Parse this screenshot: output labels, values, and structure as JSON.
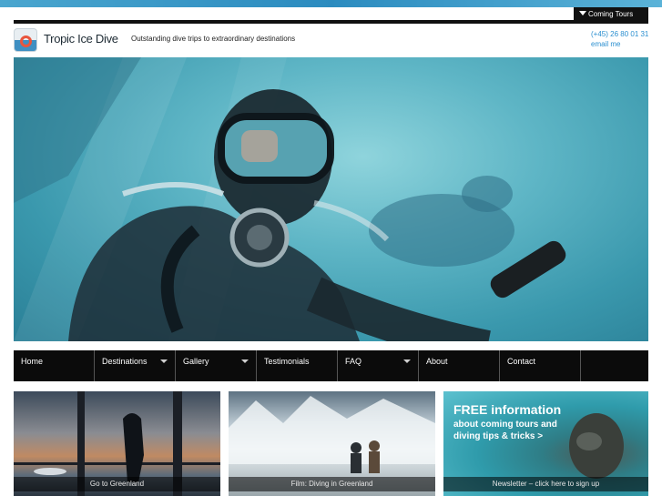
{
  "header": {
    "coming_tours": "Coming Tours",
    "brand": "Tropic Ice Dive",
    "tagline": "Outstanding dive trips to extraordinary destinations",
    "phone": "(+45) 26 80 01 31",
    "email": "email me"
  },
  "nav": {
    "items": [
      {
        "label": "Home",
        "dropdown": false
      },
      {
        "label": "Destinations",
        "dropdown": true
      },
      {
        "label": "Gallery",
        "dropdown": true
      },
      {
        "label": "Testimonials",
        "dropdown": false
      },
      {
        "label": "FAQ",
        "dropdown": true
      },
      {
        "label": "About",
        "dropdown": false
      },
      {
        "label": "Contact",
        "dropdown": false
      }
    ]
  },
  "promos": [
    {
      "caption": "Go to Greenland"
    },
    {
      "caption": "Film: Diving in Greenland"
    },
    {
      "headline": "FREE information",
      "line1": "about coming tours and",
      "line2": "diving tips & tricks >",
      "caption": "Newsletter – click here to sign up"
    }
  ],
  "colors": {
    "accent_link": "#2a8fd0",
    "nav_bg": "#0b0b0b",
    "top_band": "#2b8bbf"
  }
}
